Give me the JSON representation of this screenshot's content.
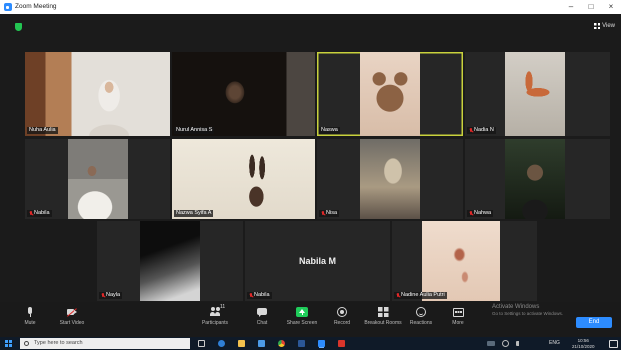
{
  "window": {
    "title": "Zoom Meeting",
    "controls": {
      "minimize": "–",
      "maximize": "□",
      "close": "×"
    }
  },
  "meeting": {
    "view_label": "View",
    "security_icon": "shield-icon"
  },
  "participants": [
    {
      "name": "Nuha Aulia"
    },
    {
      "name": "Nurul Annisa S"
    },
    {
      "name": "Naswa"
    },
    {
      "name": "Nadia N"
    },
    {
      "name": "Nabila"
    },
    {
      "name": "Nazwa Syifa A"
    },
    {
      "name": "Nisa"
    },
    {
      "name": "Nahwa"
    },
    {
      "name": "Nayla"
    },
    {
      "name": "Nabila"
    },
    {
      "name": "Nadine Aulia Putri"
    }
  ],
  "no_video_name": "Nabila M",
  "toolbar": {
    "mute": "Mute",
    "video": "Start Video",
    "participants": "Participants",
    "participant_count": "11",
    "chat": "Chat",
    "share": "Share Screen",
    "record": "Record",
    "breakout": "Breakout Rooms",
    "reactions": "Reactions",
    "more": "More",
    "end": "End"
  },
  "watermark": {
    "line1": "Activate Windows",
    "line2": "Go to Settings to activate Windows."
  },
  "taskbar": {
    "search_placeholder": "Type here to search",
    "lang": "ENG",
    "time": "10:56",
    "date": "21/10/2020",
    "apps": [
      "task-view-icon",
      "edge-icon",
      "file-explorer-icon",
      "store-icon",
      "chrome-icon",
      "word-icon",
      "zoom-icon",
      "acrobat-icon"
    ]
  },
  "colors": {
    "accent": "#2d8cff",
    "share_green": "#1fcc5a",
    "active_speaker_border": "#c9d23c",
    "muted_red": "#e02828",
    "background": "#1b1b1b"
  }
}
